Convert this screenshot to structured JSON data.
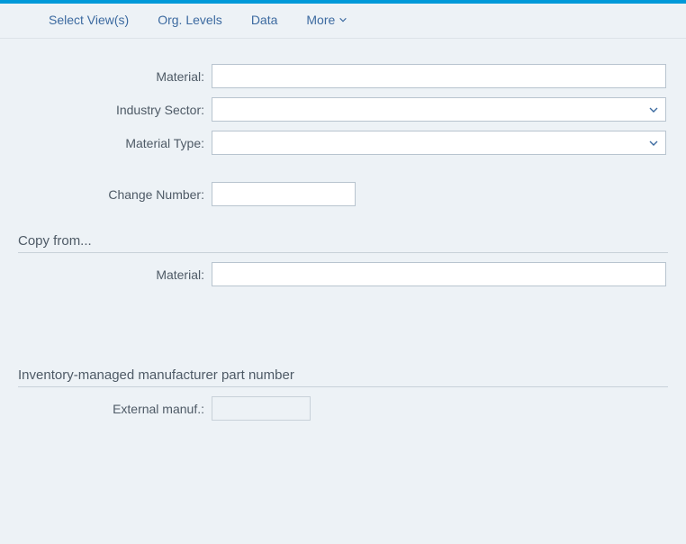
{
  "toolbar": {
    "select_views": "Select View(s)",
    "org_levels": "Org. Levels",
    "data": "Data",
    "more": "More"
  },
  "form": {
    "material_label": "Material:",
    "material_value": "",
    "industry_sector_label": "Industry Sector:",
    "industry_sector_value": "",
    "material_type_label": "Material Type:",
    "material_type_value": "",
    "change_number_label": "Change Number:",
    "change_number_value": ""
  },
  "copy_from": {
    "title": "Copy from...",
    "material_label": "Material:",
    "material_value": ""
  },
  "inv_part": {
    "title": "Inventory-managed manufacturer part number",
    "external_manuf_label": "External manuf.:",
    "external_manuf_value": ""
  },
  "colors": {
    "accent": "#0099d9",
    "link": "#3c6aa0",
    "bg": "#edf2f6",
    "border": "#b8c4cf"
  }
}
